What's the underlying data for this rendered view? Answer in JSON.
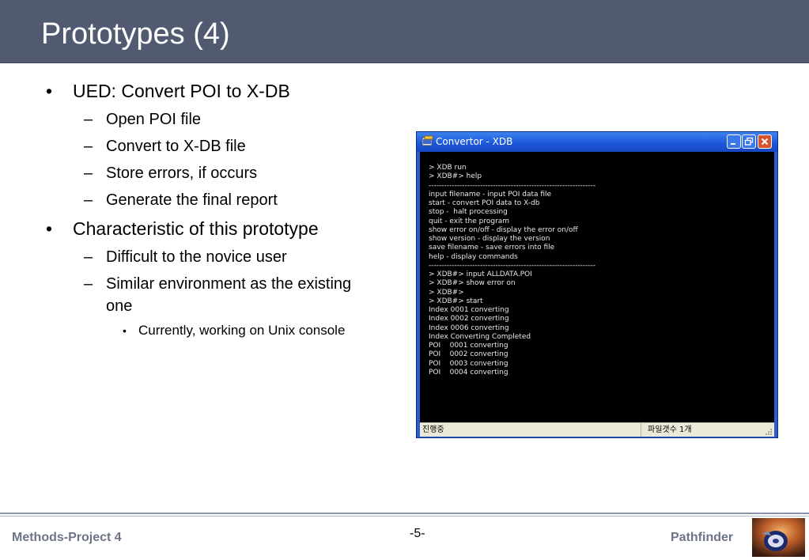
{
  "slide": {
    "title": "Prototypes (4)",
    "bullets": [
      {
        "text": "UED: Convert POI to X-DB",
        "sub": [
          "Open POI file",
          "Convert to X-DB file",
          "Store errors, if occurs",
          "Generate the final report"
        ]
      },
      {
        "text": "Characteristic of this prototype",
        "sub": [
          "Difficult to the novice user",
          "Similar environment as the existing",
          "one"
        ],
        "subsub": [
          "Currently, working on Unix console"
        ]
      }
    ],
    "bullet_mark": "•",
    "dash_mark": "–"
  },
  "window": {
    "title": "Convertor - XDB",
    "icons": [
      "app-icon",
      "minimize-icon",
      "maximize-icon",
      "close-icon"
    ],
    "console_lines": [
      "> XDB run",
      "> XDB#> help",
      "-----------------------------------------------------------------",
      "input filename - input POI data file",
      "start - convert POI data to X-db",
      "stop -  halt processing",
      "quit - exit the program",
      "show error on/off - display the error on/off",
      "show version - display the version",
      "save filename - save errors into file",
      "help - display commands",
      "-----------------------------------------------------------------",
      "> XDB#> input ALLDATA.POI",
      "> XDB#> show error on",
      "> XDB#>",
      "> XDB#> start",
      "Index 0001 converting",
      "Index 0002 converting",
      "Index 0006 converting",
      "Index Converting Completed",
      "POI    0001 converting",
      "POI    0002 converting",
      "POI    0003 converting",
      "POI    0004 converting"
    ],
    "status_left": "진행중",
    "status_right": "파일갯수 1개"
  },
  "footer": {
    "left": "Methods-Project 4",
    "page": "-5-",
    "right": "Pathfinder"
  },
  "colors": {
    "header": "#525a72",
    "titlebar": "#1b55d8",
    "console_bg": "#000000",
    "footer_text": "#6d7489"
  }
}
